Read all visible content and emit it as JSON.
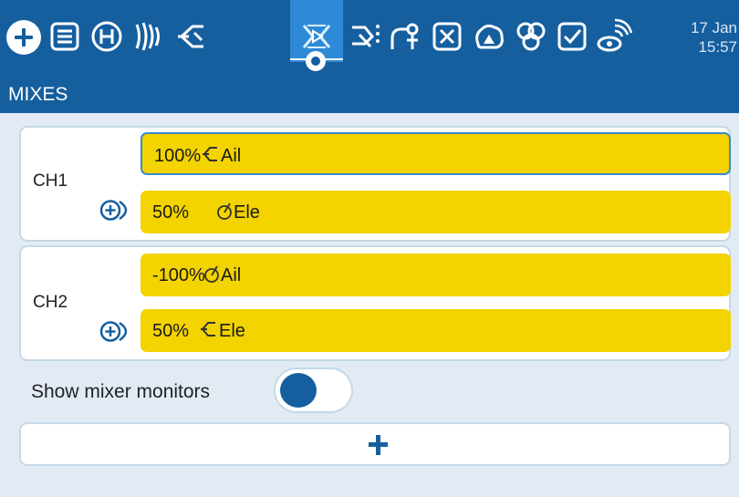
{
  "header": {
    "date": "17 Jan",
    "time": "15:57",
    "tabs": [
      {
        "name": "model-setup-icon"
      },
      {
        "name": "heli-icon"
      },
      {
        "name": "flight-modes-icon"
      },
      {
        "name": "inputs-icon"
      },
      {
        "name": "mixes-icon"
      },
      {
        "name": "outputs-icon"
      },
      {
        "name": "curves-icon"
      },
      {
        "name": "global-variables-icon"
      },
      {
        "name": "logical-switches-icon"
      },
      {
        "name": "special-functions-icon"
      },
      {
        "name": "checklist-icon"
      },
      {
        "name": "telemetry-icon"
      }
    ]
  },
  "page": {
    "title": "MIXES"
  },
  "channels": [
    {
      "label": "CH1",
      "lines": [
        {
          "value": "100%",
          "icon": "input-icon",
          "source": "Ail"
        },
        {
          "value": "50%",
          "icon": "stick-icon",
          "source": "Ele"
        }
      ]
    },
    {
      "label": "CH2",
      "lines": [
        {
          "value": "-100%",
          "icon": "stick-icon",
          "source": "Ail"
        },
        {
          "value": "50%",
          "icon": "input-icon",
          "source": "Ele"
        }
      ]
    }
  ],
  "monitors": {
    "label": "Show mixer monitors",
    "enabled": false
  },
  "colors": {
    "header": "#155f9f",
    "active_tab": "#2e8ad6",
    "mix_line": "#f3d300"
  }
}
